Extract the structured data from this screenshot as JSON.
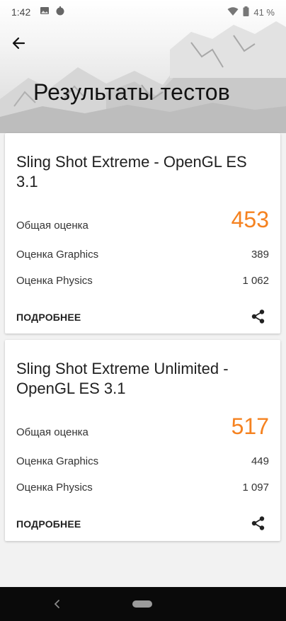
{
  "status_bar": {
    "time": "1:42",
    "battery": "41 %"
  },
  "header": {
    "title": "Результаты тестов"
  },
  "results": [
    {
      "title": "Sling Shot Extreme - OpenGL ES 3.1",
      "overall_label": "Общая оценка",
      "overall_score": "453",
      "graphics_label": "Оценка Graphics",
      "graphics_score": "389",
      "physics_label": "Оценка Physics",
      "physics_score": "1 062",
      "details_label": "ПОДРОБНЕЕ"
    },
    {
      "title": "Sling Shot Extreme Unlimited - OpenGL ES 3.1",
      "overall_label": "Общая оценка",
      "overall_score": "517",
      "graphics_label": "Оценка Graphics",
      "graphics_score": "449",
      "physics_label": "Оценка Physics",
      "physics_score": "1 097",
      "details_label": "ПОДРОБНЕЕ"
    }
  ],
  "colors": {
    "accent": "#f58220",
    "nav_bar": "#0a0a0a"
  }
}
